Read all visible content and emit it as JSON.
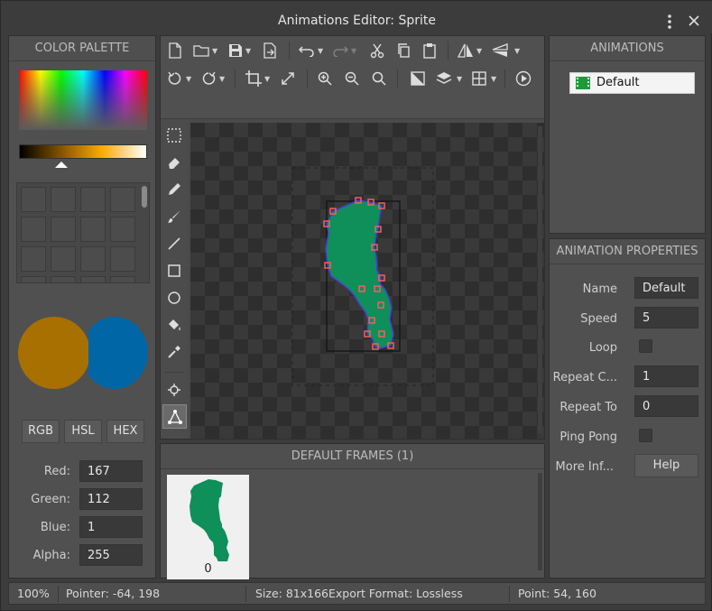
{
  "window": {
    "title": "Animations Editor: Sprite"
  },
  "color_palette": {
    "title": "COLOR PALETTE",
    "mode_buttons": [
      "RGB",
      "HSL",
      "HEX"
    ],
    "primary_color": "#a77001",
    "secondary_color": "#0066a6",
    "fields": [
      {
        "label": "Red:",
        "value": "167"
      },
      {
        "label": "Green:",
        "value": "112"
      },
      {
        "label": "Blue:",
        "value": "1"
      },
      {
        "label": "Alpha:",
        "value": "255"
      }
    ]
  },
  "animations": {
    "title": "ANIMATIONS",
    "items": [
      {
        "label": "Default",
        "selected": true
      }
    ]
  },
  "animation_properties": {
    "title": "ANIMATION PROPERTIES",
    "name": {
      "label": "Name",
      "value": "Default"
    },
    "speed": {
      "label": "Speed",
      "value": "5"
    },
    "loop": {
      "label": "Loop",
      "checked": false
    },
    "repeat_count": {
      "label": "Repeat C...",
      "value": "1"
    },
    "repeat_to": {
      "label": "Repeat To",
      "value": "0"
    },
    "ping_pong": {
      "label": "Ping Pong",
      "checked": false
    },
    "more_info": {
      "label": "More Inf...",
      "button": "Help"
    }
  },
  "frames": {
    "title": "DEFAULT FRAMES (1)",
    "items": [
      {
        "index": "0"
      }
    ]
  },
  "status": {
    "zoom": "100%",
    "pointer": "Pointer: -64, 198",
    "size": "Size: 81x166",
    "export": "Export Format: Lossless",
    "point": "Point: 54, 160"
  },
  "colors": {
    "sprite_fill": "#0f8f5a",
    "point_marker": "#f06060",
    "outline": "#4a3cd6"
  },
  "icons": {
    "toolbar_row1": [
      "new-file-icon",
      "open-folder-icon",
      "save-icon",
      "export-icon",
      "undo-icon",
      "redo-icon",
      "cut-icon",
      "copy-icon",
      "paste-icon",
      "flip-horizontal-icon",
      "flip-vertical-icon"
    ],
    "toolbar_row2": [
      "rotate-left-icon",
      "rotate-right-icon",
      "crop-icon",
      "resize-icon",
      "zoom-in-icon",
      "zoom-out-icon",
      "zoom-fit-icon",
      "transparency-icon",
      "layers-icon",
      "grid-icon",
      "play-icon"
    ],
    "tools": [
      "rect-select-icon",
      "eraser-icon",
      "pencil-icon",
      "brush-icon",
      "line-icon",
      "rectangle-icon",
      "ellipse-icon",
      "fill-bucket-icon",
      "eyedropper-icon",
      "origin-icon",
      "polygon-points-icon"
    ]
  }
}
